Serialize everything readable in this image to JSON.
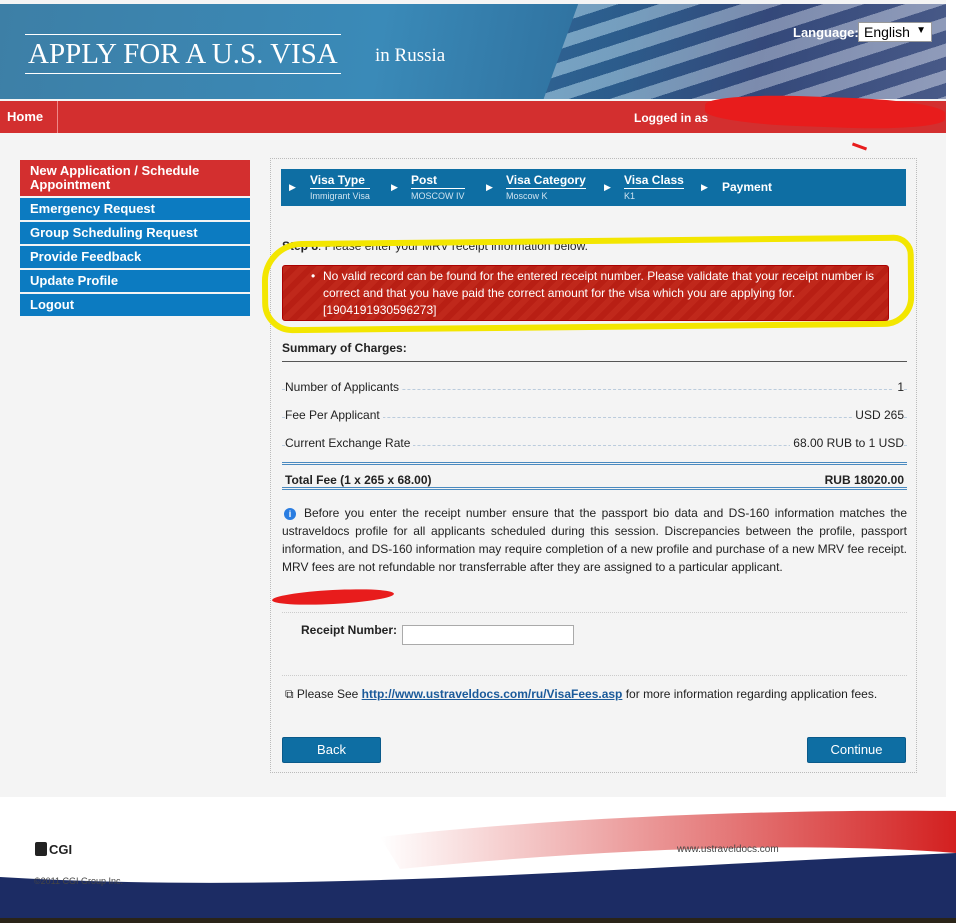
{
  "header": {
    "title": "APPLY FOR A U.S. VISA",
    "country": "in  Russia",
    "language_label": "Language:",
    "language_value": "English"
  },
  "nav": {
    "home": "Home",
    "logged_in": "Logged in as"
  },
  "sidebar": {
    "items": [
      {
        "label": "New Application / Schedule Appointment",
        "active": true
      },
      {
        "label": "Emergency Request"
      },
      {
        "label": "Group Scheduling Request"
      },
      {
        "label": "Provide Feedback"
      },
      {
        "label": "Update Profile"
      },
      {
        "label": "Logout"
      }
    ]
  },
  "steps": [
    {
      "title": "Visa Type",
      "value": "Immigrant Visa"
    },
    {
      "title": "Post",
      "value": "MOSCOW IV"
    },
    {
      "title": "Visa Category",
      "value": "Moscow K"
    },
    {
      "title": "Visa Class",
      "value": "K1"
    },
    {
      "title": "Payment"
    }
  ],
  "step_label": "Step 8",
  "step_text": ": Please enter your MRV receipt information below.",
  "error": {
    "message": "No valid record can be found for the entered receipt number. Please validate that your receipt number is correct and that you have paid the correct amount for the visa which you are applying for.",
    "code": "[1904191930596273]"
  },
  "summary": {
    "title": "Summary of Charges:",
    "rows": [
      {
        "label": "Number of Applicants",
        "value": "1"
      },
      {
        "label": "Fee Per Applicant",
        "value": "USD 265"
      },
      {
        "label": "Current Exchange Rate",
        "value": "68.00 RUB to 1 USD"
      }
    ],
    "total_label": "Total Fee (1 x 265 x 68.00)",
    "total_value": "RUB 18020.00"
  },
  "info": "Before you enter the receipt number ensure that the passport bio data and DS-160 information matches the ustraveldocs profile for all applicants scheduled during this session. Discrepancies between the profile, passport information, and DS-160 information may require completion of a new profile and purchase of a new MRV fee receipt. MRV fees are not refundable nor transferrable after they are assigned to a particular applicant.",
  "receipt": {
    "label": "Receipt Number:",
    "value": ""
  },
  "fees_link": {
    "prefix": "Please See ",
    "url": "http://www.ustraveldocs.com/ru/VisaFees.asp",
    "suffix": " for more information regarding application fees."
  },
  "buttons": {
    "back": "Back",
    "continue": "Continue"
  },
  "footer": {
    "logo": "CGI",
    "copyright": "©2011 CGI Group Inc.",
    "site": "www.ustraveldocs.com"
  },
  "colors": {
    "nav_red": "#d32f2f",
    "sidebar_blue": "#0c7bc1",
    "steps_blue": "#0e6ea3",
    "error_red": "#c0281b",
    "highlight_yellow": "#f3e600"
  }
}
